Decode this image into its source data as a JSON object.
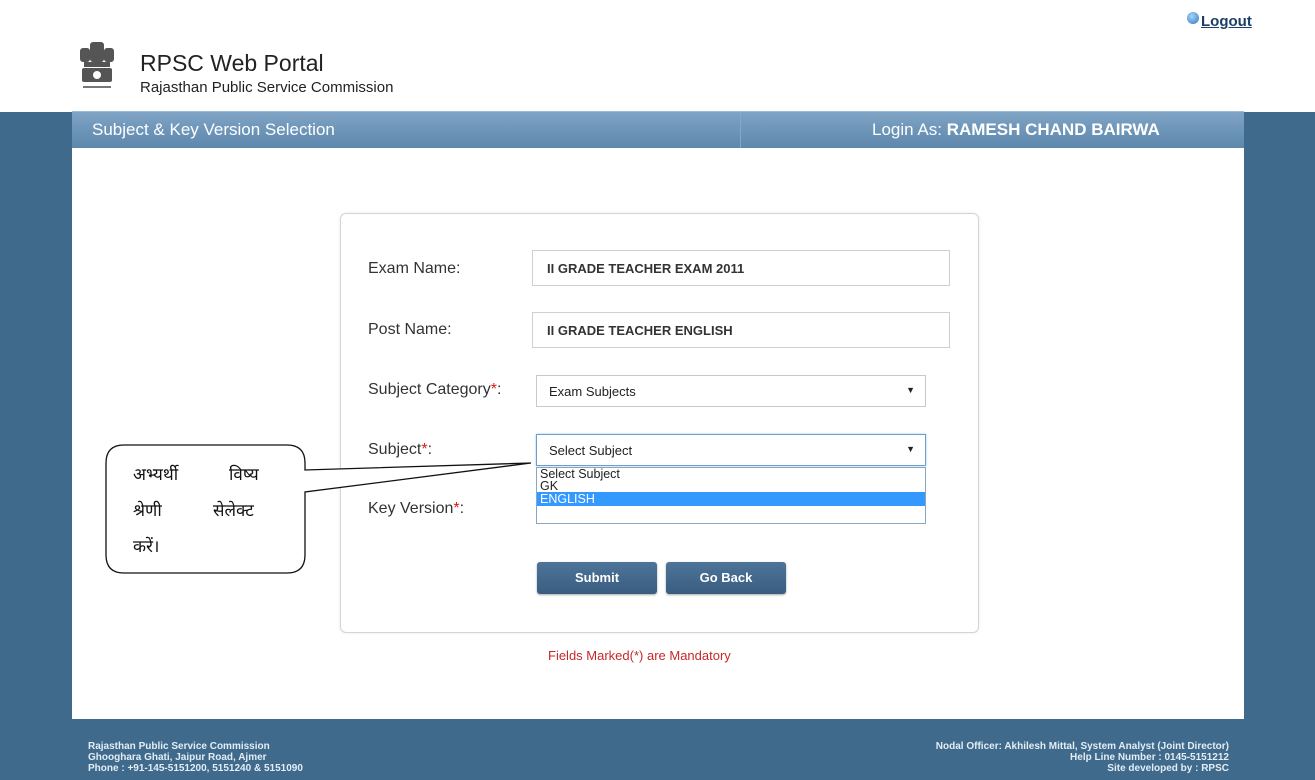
{
  "header": {
    "logout_label": "Logout",
    "title": "RPSC Web Portal",
    "subtitle": "Rajasthan Public Service Commission"
  },
  "bar": {
    "title": "Subject & Key Version Selection",
    "login_as_label": "Login As:",
    "user": "RAMESH CHAND BAIRWA"
  },
  "form": {
    "exam_name_label": "Exam Name:",
    "exam_name_value": "II GRADE TEACHER EXAM 2011",
    "post_name_label": "Post Name:",
    "post_name_value": "II GRADE TEACHER ENGLISH",
    "subject_category_label": "Subject Category",
    "subject_category_value": "Exam Subjects",
    "subject_label": "Subject",
    "subject_value": "Select Subject",
    "subject_options": [
      "Select Subject",
      "GK",
      "ENGLISH"
    ],
    "key_version_label": "Key Version",
    "required_marker": "*",
    "colon": ":",
    "submit_label": "Submit",
    "go_back_label": "Go Back",
    "mandatory_note": "Fields Marked(*) are Mandatory"
  },
  "callout": {
    "line1_word1": "अभ्यर्थी",
    "line1_word2": "विष्य",
    "line2_word1": "श्रेणी",
    "line2_word2": "सेलेक्ट",
    "line3": "करें।"
  },
  "footer": {
    "left": [
      "Rajasthan Public Service Commission",
      "Ghooghara Ghati, Jaipur Road, Ajmer",
      "Phone : +91-145-5151200, 5151240 & 5151090"
    ],
    "right": [
      "Nodal Officer: Akhilesh Mittal, System Analyst (Joint Director)",
      "Help Line Number : 0145-5151212",
      "Site developed by : RPSC"
    ]
  },
  "colors": {
    "accent": "#3f6a8c",
    "bar": "#6f97bb",
    "button": "#426789",
    "required": "#d81b1b",
    "highlight": "#3399ff"
  }
}
